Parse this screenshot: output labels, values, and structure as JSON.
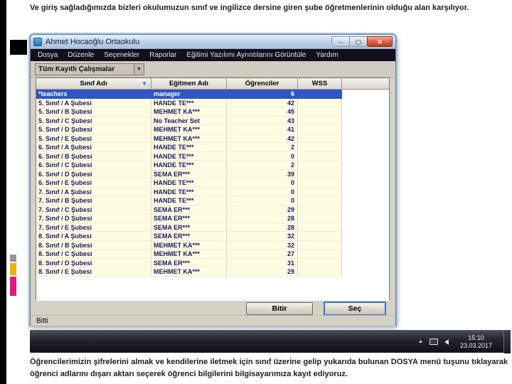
{
  "slide": {
    "top_text": "Ve giriş sağladığımızda bizleri okulumuzun sınıf ve ingilizce dersine giren şube öğretmenlerinin olduğu alan karşılıyor.",
    "bottom_text": "Öğrencilerimizin şifrelerini almak ve kendilerine iletmek için sınıf üzerine gelip yukarıda bulunan DOSYA menü tuşunu tıklayarak öğrenci adlarını dışarı aktarı seçerek öğrenci bilgilerini bilgisayarımıza kayıt ediyoruz."
  },
  "window": {
    "title": "Ahmet Hocaoğlu Ortaokulu",
    "menu": [
      "Dosya",
      "Düzenle",
      "Seçenekler",
      "Raporlar",
      "Eğitimi Yazılımı Ayrıntılarını Görüntüle",
      "Yardım"
    ],
    "filter_value": "Tüm Kayıtlı Çalışmalar",
    "status": "Bitti",
    "finish_button": "Bitir",
    "select_button": "Seç"
  },
  "table": {
    "headers": [
      "Sınıf Adı",
      "Eğitmen Adı",
      "Öğrenciler",
      "WSS"
    ],
    "rows": [
      {
        "class": "*teachers",
        "teacher": "manager",
        "students": "6",
        "selected": true
      },
      {
        "class": "5. Sınıf / A Şubesi",
        "teacher": "HANDE TE***",
        "students": "42"
      },
      {
        "class": "5. Sınıf / B Şubesi",
        "teacher": "MEHMET KA***",
        "students": "45"
      },
      {
        "class": "5. Sınıf / C Şubesi",
        "teacher": "No Teacher Set",
        "students": "43"
      },
      {
        "class": "5. Sınıf / D Şubesi",
        "teacher": "MEHMET KA***",
        "students": "41"
      },
      {
        "class": "5. Sınıf / E Şubesi",
        "teacher": "MEHMET KA***",
        "students": "42"
      },
      {
        "class": "6. Sınıf / A Şubesi",
        "teacher": "HANDE TE***",
        "students": "2"
      },
      {
        "class": "6. Sınıf / B Şubesi",
        "teacher": "HANDE TE***",
        "students": "0"
      },
      {
        "class": "6. Sınıf / C Şubesi",
        "teacher": "HANDE TE***",
        "students": "2"
      },
      {
        "class": "6. Sınıf / D Şubesi",
        "teacher": "SEMA ER***",
        "students": "39"
      },
      {
        "class": "6. Sınıf / E Şubesi",
        "teacher": "HANDE TE***",
        "students": "0"
      },
      {
        "class": "7. Sınıf / A Şubesi",
        "teacher": "HANDE TE***",
        "students": "0"
      },
      {
        "class": "7. Sınıf / B Şubesi",
        "teacher": "HANDE TE***",
        "students": "0"
      },
      {
        "class": "7. Sınıf / C Şubesi",
        "teacher": "SEMA ER***",
        "students": "29"
      },
      {
        "class": "7. Sınıf / D Şubesi",
        "teacher": "SEMA ER***",
        "students": "28"
      },
      {
        "class": "7. Sınıf / E Şubesi",
        "teacher": "SEMA ER***",
        "students": "28"
      },
      {
        "class": "8. Sınıf / A Şubesi",
        "teacher": "SEMA ER***",
        "students": "32"
      },
      {
        "class": "8. Sınıf / B Şubesi",
        "teacher": "MEHMET KA***",
        "students": "32"
      },
      {
        "class": "8. Sınıf / C Şubesi",
        "teacher": "MEHMET KA***",
        "students": "27"
      },
      {
        "class": "8. Sınıf / D Şubesi",
        "teacher": "SEMA ER***",
        "students": "31"
      },
      {
        "class": "8. Sınıf / E Şubesi",
        "teacher": "MEHMET KA***",
        "students": "29"
      }
    ]
  },
  "taskbar": {
    "time": "15:10",
    "date": "23.03.2017"
  },
  "icons": {
    "minimize": "–",
    "maximize": "▢",
    "close": "✕",
    "sort": "▼",
    "combo_arrow": "▼",
    "tray_chevron": "▲"
  },
  "colors": {
    "selection": "#3255c5",
    "cell_bg": "#fffce4",
    "titlebar": "#c3d6ec",
    "menubar": "#150e1d",
    "accent_magenta": "#e0187f"
  }
}
